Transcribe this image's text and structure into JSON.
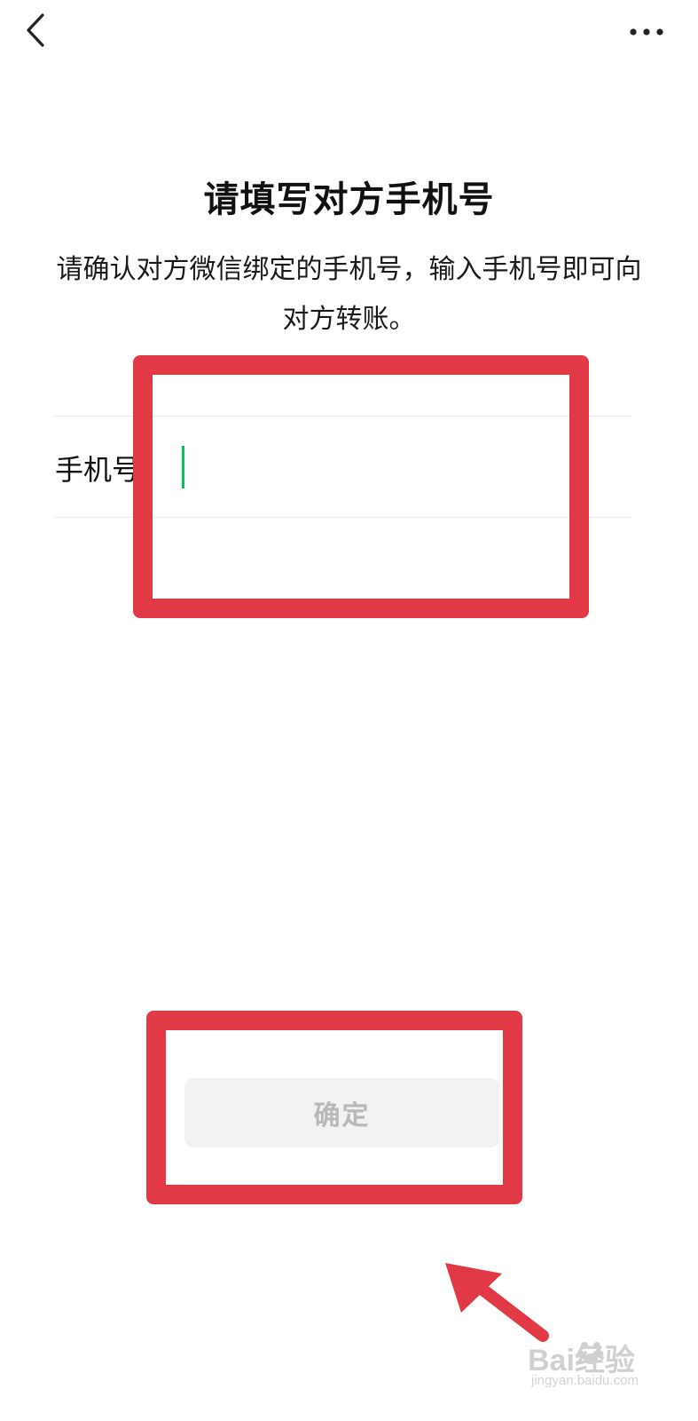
{
  "nav": {
    "back_icon": "chevron-left-icon",
    "more_icon": "more-horizontal-icon"
  },
  "header": {
    "title": "请填写对方手机号",
    "subtitle": "请确认对方微信绑定的手机号，输入手机号即可向对方转账。"
  },
  "form": {
    "phone_label": "手机号",
    "phone_value": "",
    "phone_placeholder": ""
  },
  "actions": {
    "confirm_label": "确定"
  },
  "colors": {
    "accent_caret": "#07c160",
    "annotation_red": "#e13946",
    "button_bg_disabled": "#f2f2f2",
    "button_text_disabled": "#b8b8b8"
  },
  "watermark": {
    "logo_text": "Bai经验",
    "url_text": "jingyan.baidu.com"
  }
}
